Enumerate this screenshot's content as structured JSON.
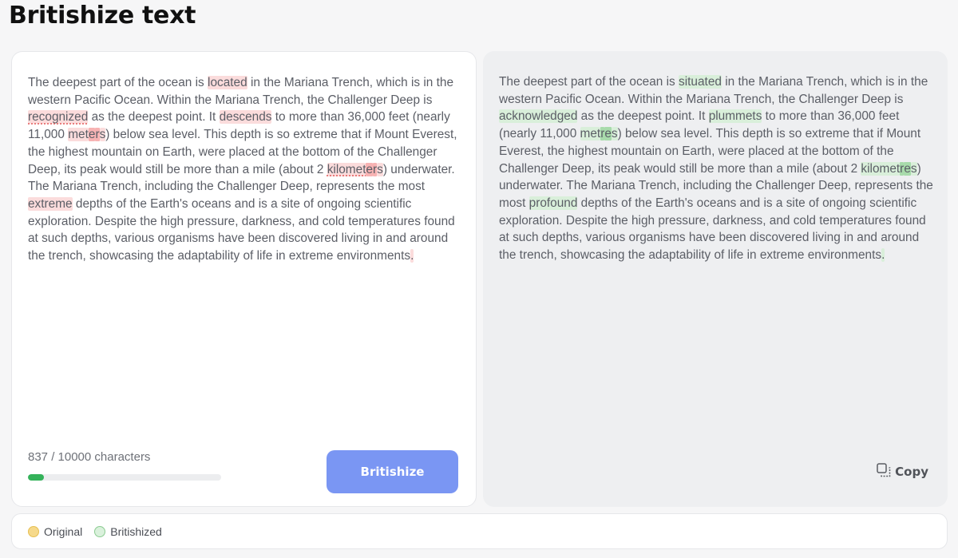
{
  "page": {
    "title": "Britishize text"
  },
  "original": {
    "segments": [
      {
        "t": "The deepest part of the ocean is ",
        "h": ""
      },
      {
        "t": "located",
        "h": "red"
      },
      {
        "t": " in the Mariana Trench, which is in the western Pacific Ocean. Within the Mariana Trench, the Challenger Deep is ",
        "h": ""
      },
      {
        "t": "recognized",
        "h": "red-squiggle"
      },
      {
        "t": " as the deepest point. It ",
        "h": ""
      },
      {
        "t": "descends",
        "h": "red"
      },
      {
        "t": " to more than 36,000 feet (nearly 11,000 ",
        "h": ""
      },
      {
        "t": "met",
        "h": "red"
      },
      {
        "t": "e",
        "h": "red-strong"
      },
      {
        "t": "r",
        "h": "red-strong"
      },
      {
        "t": "s",
        "h": "red"
      },
      {
        "t": ") below sea level. This depth is so extreme that if Mount Everest, the highest mountain on Earth, were placed at the bottom of the Challenger Deep, its peak would still be more than a mile (about 2 ",
        "h": ""
      },
      {
        "t": "kilomet",
        "h": "red-squiggle"
      },
      {
        "t": "e",
        "h": "red-strong"
      },
      {
        "t": "r",
        "h": "red-strong"
      },
      {
        "t": "s",
        "h": "red"
      },
      {
        "t": ") underwater. The Mariana Trench, including the Challenger Deep, represents the most ",
        "h": ""
      },
      {
        "t": "extreme",
        "h": "red"
      },
      {
        "t": " depths of the Earth's oceans and is a site of ongoing scientific exploration. Despite the high pressure, darkness, and cold temperatures found at such depths, various organisms have been discovered living in and around the trench, showcasing the adaptability of life in extreme environments",
        "h": ""
      },
      {
        "t": ".",
        "h": "red"
      }
    ],
    "char_count": "837 / 10000 characters",
    "progress_fraction": 0.0837,
    "button_label": "Britishize"
  },
  "britishized": {
    "segments": [
      {
        "t": "The deepest part of the ocean is ",
        "h": ""
      },
      {
        "t": "situated",
        "h": "green"
      },
      {
        "t": " in the Mariana Trench, which is in the western Pacific Ocean. Within the Mariana Trench, the Challenger Deep is ",
        "h": ""
      },
      {
        "t": "acknowledged",
        "h": "green"
      },
      {
        "t": " as the deepest point. It ",
        "h": ""
      },
      {
        "t": "plummets",
        "h": "green"
      },
      {
        "t": " to more than 36,000 feet (nearly 11,000 ",
        "h": ""
      },
      {
        "t": "met",
        "h": "green"
      },
      {
        "t": "r",
        "h": "green-strong"
      },
      {
        "t": "e",
        "h": "green-strong"
      },
      {
        "t": "s",
        "h": "green"
      },
      {
        "t": ") below sea level. This depth is so extreme that if Mount Everest, the highest mountain on Earth, were placed at the bottom of the Challenger Deep, its peak would still be more than a mile (about 2 ",
        "h": ""
      },
      {
        "t": "kilomet",
        "h": "green"
      },
      {
        "t": "r",
        "h": "green-strong"
      },
      {
        "t": "e",
        "h": "green-strong"
      },
      {
        "t": "s",
        "h": "green"
      },
      {
        "t": ") underwater. The Mariana Trench, including the Challenger Deep, represents the most ",
        "h": ""
      },
      {
        "t": "profound",
        "h": "green"
      },
      {
        "t": " depths of the Earth's oceans and is a site of ongoing scientific exploration. Despite the high pressure, darkness, and cold temperatures found at such depths, various organisms have been discovered living in and around the trench, showcasing the adaptability of life in extreme environments",
        "h": ""
      },
      {
        "t": ".",
        "h": "green"
      }
    ],
    "copy_label": "Copy",
    "copy_icon": "copy-icon"
  },
  "legend": {
    "original_label": "Original",
    "britishized_label": "Britishized"
  },
  "colors": {
    "accent_button": "#7a96f3",
    "progress": "#34b25a",
    "removed_highlight": "#fbdcdc",
    "added_highlight": "#d9efda",
    "original_swatch": "#f6d98a",
    "britishized_swatch": "#daf1dc"
  }
}
